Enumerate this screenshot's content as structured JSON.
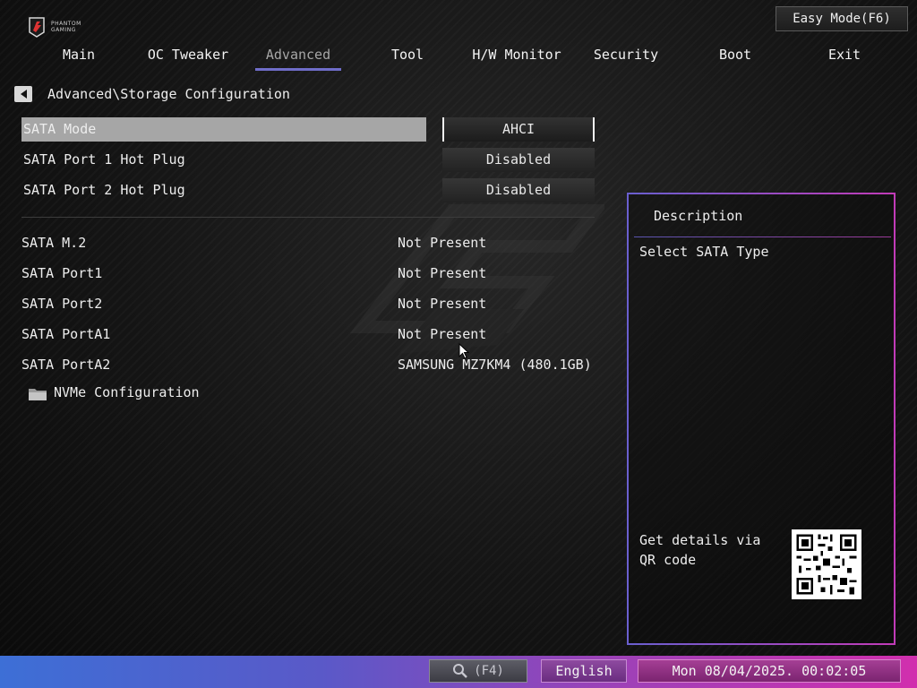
{
  "logo": {
    "text_line1": "PHANTOM",
    "text_line2": "GAMING"
  },
  "easy_mode": {
    "label": "Easy Mode(F6)"
  },
  "nav": {
    "tabs": [
      {
        "label": "Main"
      },
      {
        "label": "OC Tweaker"
      },
      {
        "label": "Advanced"
      },
      {
        "label": "Tool"
      },
      {
        "label": "H/W Monitor"
      },
      {
        "label": "Security"
      },
      {
        "label": "Boot"
      },
      {
        "label": "Exit"
      }
    ],
    "active": "Advanced",
    "accent_color": "#6f6dc9"
  },
  "breadcrumb": {
    "text": "Advanced\\Storage Configuration"
  },
  "settings": [
    {
      "label": "SATA Mode",
      "value": "AHCI"
    },
    {
      "label": "SATA Port 1 Hot Plug",
      "value": "Disabled"
    },
    {
      "label": "SATA Port 2 Hot Plug",
      "value": "Disabled"
    }
  ],
  "ports": [
    {
      "label": "SATA M.2",
      "status": "Not Present"
    },
    {
      "label": "SATA Port1",
      "status": "Not Present"
    },
    {
      "label": "SATA Port2",
      "status": "Not Present"
    },
    {
      "label": "SATA PortA1",
      "status": "Not Present"
    },
    {
      "label": "SATA PortA2",
      "status": "SAMSUNG MZ7KM4 (480.1GB)"
    }
  ],
  "submenu": {
    "label": "NVMe Configuration",
    "icon": "folder-icon"
  },
  "description": {
    "title": "Description",
    "text": "Select SATA Type",
    "qr_text": "Get details via QR code"
  },
  "bottom": {
    "search_label": "(F4)",
    "language": "English",
    "datetime": "Mon 08/04/2025. 00:02:05"
  },
  "colors": {
    "highlight": "#a6a6a6",
    "panel_left": "#6a5fcf",
    "panel_right": "#c13bb8"
  }
}
